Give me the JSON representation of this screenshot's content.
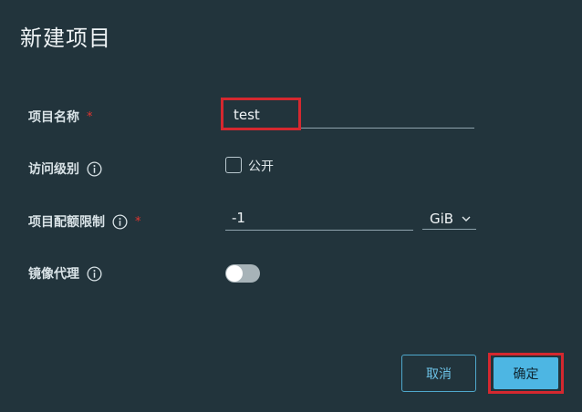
{
  "dialog": {
    "title": "新建项目"
  },
  "form": {
    "project_name": {
      "label": "项目名称",
      "required_mark": "*",
      "value": "test"
    },
    "access_level": {
      "label": "访问级别",
      "checkbox_label": "公开",
      "checked": false
    },
    "quota": {
      "label": "项目配额限制",
      "required_mark": "*",
      "value": "-1",
      "unit": "GiB"
    },
    "proxy_cache": {
      "label": "镜像代理",
      "enabled": false
    }
  },
  "buttons": {
    "cancel": "取消",
    "ok": "确定"
  },
  "colors": {
    "background": "#22343c",
    "accent": "#4db6e3",
    "highlight": "#d5282f",
    "required": "#e0342f"
  }
}
